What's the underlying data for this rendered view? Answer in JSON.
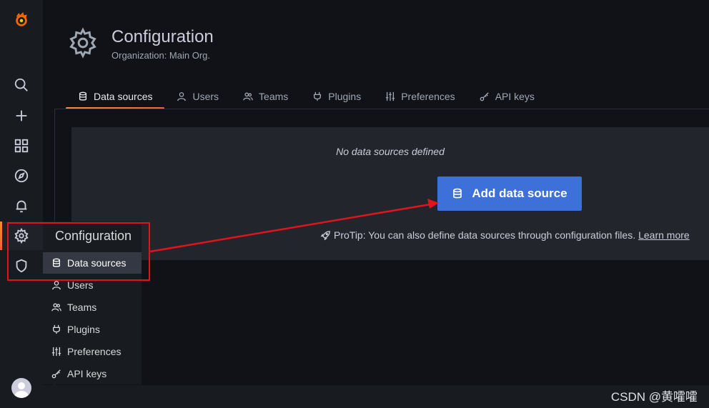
{
  "page": {
    "title": "Configuration",
    "subtitle": "Organization: Main Org."
  },
  "tabs": [
    {
      "label": "Data sources",
      "icon": "database-icon",
      "active": true
    },
    {
      "label": "Users",
      "icon": "user-icon"
    },
    {
      "label": "Teams",
      "icon": "users-icon"
    },
    {
      "label": "Plugins",
      "icon": "plug-icon"
    },
    {
      "label": "Preferences",
      "icon": "sliders-icon"
    },
    {
      "label": "API keys",
      "icon": "key-icon"
    }
  ],
  "empty_state": {
    "title": "No data sources defined",
    "button_label": "Add data source",
    "protip_text": "ProTip: You can also define data sources through configuration files.",
    "protip_link": "Learn more"
  },
  "flyout": {
    "header": "Configuration",
    "items": [
      {
        "label": "Data sources",
        "icon": "database-icon",
        "active": true
      },
      {
        "label": "Users",
        "icon": "user-icon"
      },
      {
        "label": "Teams",
        "icon": "users-icon"
      },
      {
        "label": "Plugins",
        "icon": "plug-icon"
      },
      {
        "label": "Preferences",
        "icon": "sliders-icon"
      },
      {
        "label": "API keys",
        "icon": "key-icon"
      }
    ]
  },
  "sidebar": {
    "items": [
      "grafana-logo-icon",
      "search-icon",
      "plus-icon",
      "dashboards-icon",
      "explore-icon",
      "bell-icon",
      "gear-icon",
      "shield-icon"
    ]
  },
  "colors": {
    "accent_gradient": [
      "#ff8833",
      "#f55f3e"
    ],
    "primary_button": "#3d71d9",
    "annotation": "#e0141c"
  },
  "watermark": "CSDN @黄嚯嚯"
}
